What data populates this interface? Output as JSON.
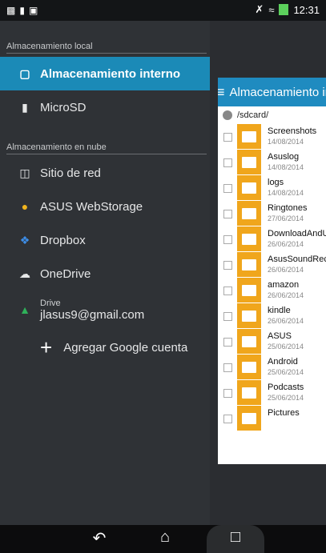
{
  "status_bar": {
    "time": "12:31"
  },
  "drawer": {
    "local_section_title": "Almacenamiento local",
    "local_items": [
      {
        "label": "Almacenamiento interno",
        "icon": "sd-card-icon",
        "active": true
      },
      {
        "label": "MicroSD",
        "icon": "microsd-icon",
        "active": false
      }
    ],
    "cloud_section_title": "Almacenamiento en nube",
    "cloud_items": [
      {
        "label": "Sitio de red",
        "icon": "network-icon"
      },
      {
        "label": "ASUS WebStorage",
        "icon": "webstorage-icon"
      },
      {
        "label": "Dropbox",
        "icon": "dropbox-icon"
      },
      {
        "label": "OneDrive",
        "icon": "onedrive-icon"
      }
    ],
    "drive": {
      "label": "Drive",
      "email": "jlasus9@gmail.com",
      "icon": "google-drive-icon"
    },
    "add_google_label": "Agregar Google cuenta"
  },
  "background_app": {
    "header_title": "Almacenamiento in",
    "path": "/sdcard/",
    "files": [
      {
        "name": "Screenshots",
        "date": "14/08/2014"
      },
      {
        "name": "Asuslog",
        "date": "14/08/2014"
      },
      {
        "name": "logs",
        "date": "14/08/2014"
      },
      {
        "name": "Ringtones",
        "date": "27/06/2014"
      },
      {
        "name": "DownloadAndU",
        "date": "26/06/2014"
      },
      {
        "name": "AsusSoundReco",
        "date": "26/06/2014"
      },
      {
        "name": "amazon",
        "date": "26/06/2014"
      },
      {
        "name": "kindle",
        "date": "26/06/2014"
      },
      {
        "name": "ASUS",
        "date": "25/06/2014"
      },
      {
        "name": "Android",
        "date": "25/06/2014"
      },
      {
        "name": "Podcasts",
        "date": "25/06/2014"
      },
      {
        "name": "Pictures",
        "date": ""
      }
    ]
  },
  "colors": {
    "accent": "#1b8ab7",
    "folder": "#f0a61c",
    "drawer_bg": "#2f3236"
  }
}
